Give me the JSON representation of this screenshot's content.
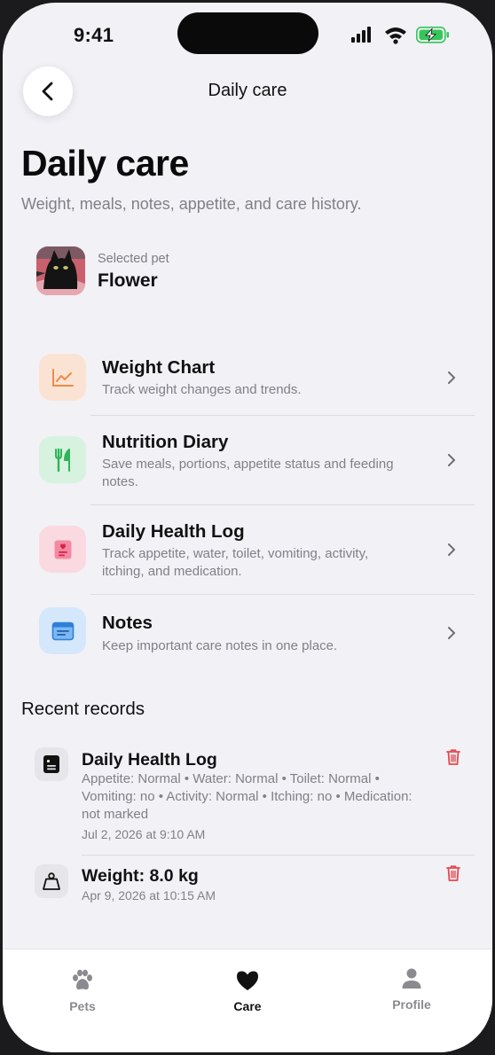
{
  "status_bar": {
    "time": "9:41"
  },
  "nav": {
    "title": "Daily care"
  },
  "header": {
    "title": "Daily care",
    "subtitle": "Weight, meals, notes, appetite, and care history."
  },
  "pet": {
    "label": "Selected pet",
    "name": "Flower"
  },
  "menu": [
    {
      "title": "Weight Chart",
      "description": "Track weight changes and trends.",
      "icon": "chart-icon",
      "icon_bg": "#fbe3d3",
      "icon_color": "#f08a4b"
    },
    {
      "title": "Nutrition Diary",
      "description": "Save meals, portions, appetite status and feeding notes.",
      "icon": "fork-knife-icon",
      "icon_bg": "#d7f2df",
      "icon_color": "#2fb45a"
    },
    {
      "title": "Daily Health Log",
      "description": "Track appetite, water, toilet, vomiting, activity, itching, and medication.",
      "icon": "health-clipboard-icon",
      "icon_bg": "#fbd9e0",
      "icon_color": "#ec5d7e"
    },
    {
      "title": "Notes",
      "description": "Keep important care notes in one place.",
      "icon": "note-icon",
      "icon_bg": "#d5e7fb",
      "icon_color": "#3a8de6"
    }
  ],
  "recent": {
    "title": "Recent records",
    "items": [
      {
        "title": "Daily Health Log",
        "description": "Appetite: Normal • Water: Normal • Toilet: Normal • Vomiting: no • Activity: Normal • Itching: no • Medication: not marked",
        "time": "Jul 2, 2026 at 9:10 AM",
        "icon": "health-log-icon"
      },
      {
        "title": "Weight: 8.0 kg",
        "description": "",
        "time": "Apr 9, 2026 at 10:15 AM",
        "icon": "weight-icon"
      }
    ]
  },
  "tabs": [
    {
      "label": "Pets",
      "icon": "paw-icon",
      "active": false
    },
    {
      "label": "Care",
      "icon": "heart-icon",
      "active": true
    },
    {
      "label": "Profile",
      "icon": "person-icon",
      "active": false
    }
  ],
  "colors": {
    "background": "#f2f1f6",
    "delete": "#e5484d",
    "battery": "#34c759"
  }
}
